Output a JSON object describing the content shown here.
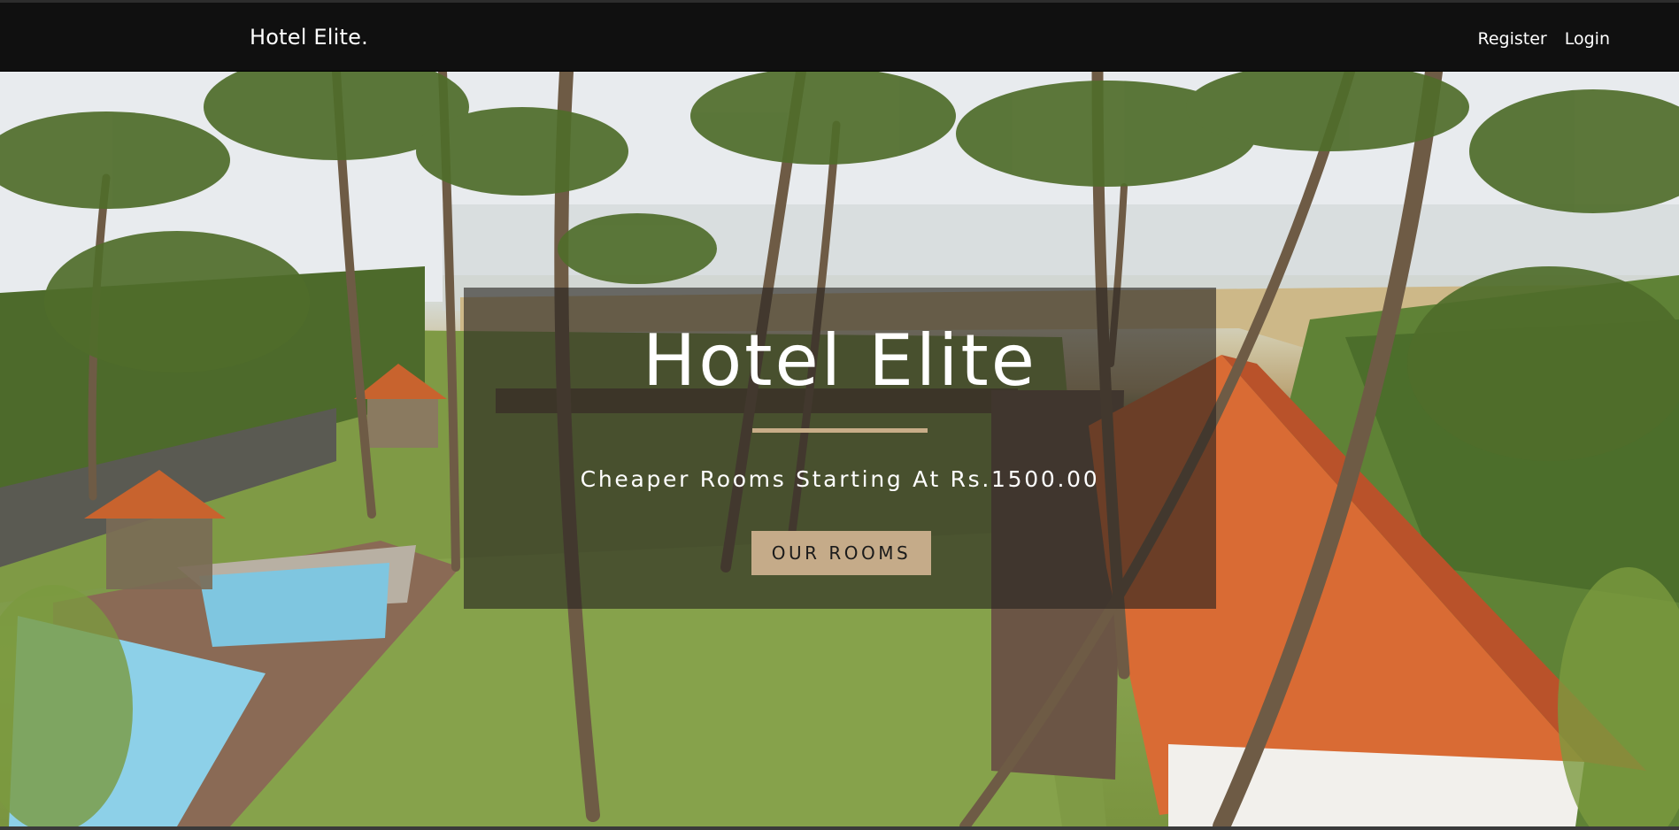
{
  "navbar": {
    "brand": "Hotel Elite.",
    "links": [
      {
        "label": "Register"
      },
      {
        "label": "Login"
      }
    ]
  },
  "hero": {
    "title": "Hotel Elite",
    "subtitle": "Cheaper Rooms Starting At Rs.1500.00",
    "button_label": "OUR ROOMS",
    "background_image": "resort-palm-trees-pool-beach-photo"
  },
  "colors": {
    "navbar_bg": "#101010",
    "accent": "#c5ab89",
    "overlay": "rgba(38,36,33,0.62)",
    "text": "#ffffff"
  }
}
